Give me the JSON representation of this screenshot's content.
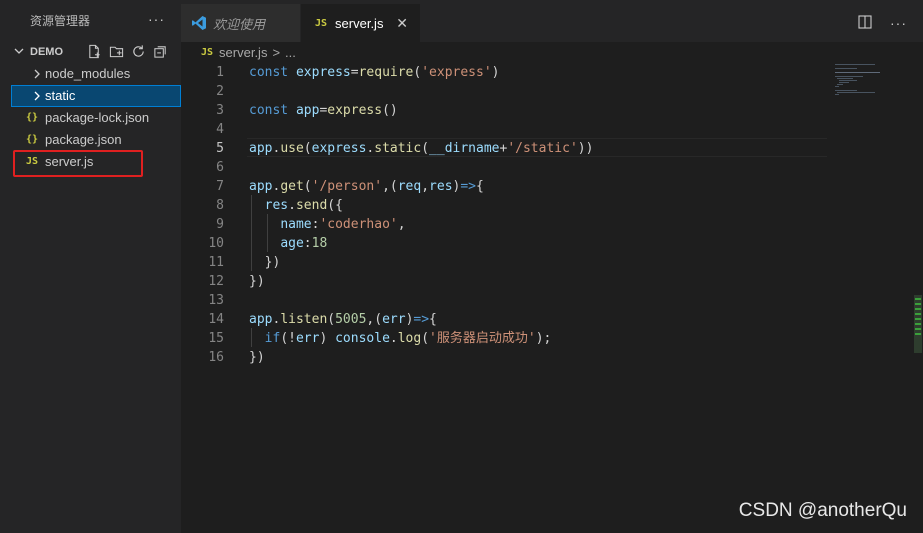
{
  "sidebar": {
    "title": "资源管理器",
    "more": "···",
    "section": "DEMO",
    "items": [
      {
        "label": "node_modules",
        "icon": "chevron-right-icon"
      },
      {
        "label": "static",
        "icon": "chevron-right-icon"
      },
      {
        "label": "package-lock.json",
        "icon": "{}"
      },
      {
        "label": "package.json",
        "icon": "{}"
      },
      {
        "label": "server.js",
        "icon": "JS"
      }
    ]
  },
  "tabs": {
    "welcome": "欢迎使用",
    "server": "server.js",
    "close": "✕",
    "js_badge": "JS"
  },
  "breadcrumb": {
    "file": "server.js",
    "sep": ">",
    "rest": "..."
  },
  "editor": {
    "line_numbers": [
      "1",
      "2",
      "3",
      "4",
      "5",
      "6",
      "7",
      "8",
      "9",
      "10",
      "11",
      "12",
      "13",
      "14",
      "15",
      "16"
    ],
    "active_line": "5",
    "lines": {
      "l1": [
        "const",
        " ",
        "express",
        "=",
        "require",
        "(",
        "'express'",
        ")"
      ],
      "l3": [
        "const",
        " ",
        "app",
        "=",
        "express",
        "()"
      ],
      "l5": [
        "app",
        ".",
        "use",
        "(",
        "express",
        ".",
        "static",
        "(",
        "__dirname",
        "+",
        "'/static'",
        ")",
        ")"
      ],
      "l7": [
        "app",
        ".",
        "get",
        "(",
        "'/person'",
        ",(",
        "req",
        ",",
        "res",
        ")",
        "=>",
        "{"
      ],
      "l8": [
        "  ",
        "res",
        ".",
        "send",
        "({"
      ],
      "l9": [
        "    ",
        "name",
        ":",
        "'coderhao'",
        ","
      ],
      "l10": [
        "    ",
        "age",
        ":",
        "18"
      ],
      "l11": [
        "  ",
        "})"
      ],
      "l12": [
        "})"
      ],
      "l14": [
        "app",
        ".",
        "listen",
        "(",
        "5005",
        ",(",
        "err",
        ")",
        "=>",
        "{"
      ],
      "l15": [
        "  ",
        "if",
        "(!",
        "err",
        ") ",
        "console",
        ".",
        "log",
        "(",
        "'服务器启动成功'",
        ");"
      ],
      "l16": [
        "})"
      ]
    }
  },
  "watermark": "CSDN @anotherQu"
}
